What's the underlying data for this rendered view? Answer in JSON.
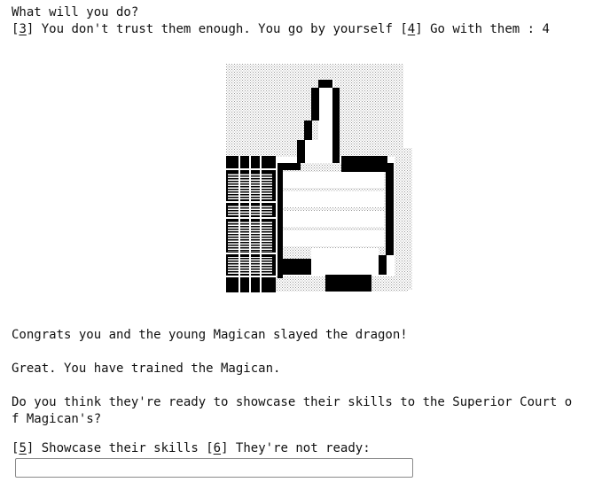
{
  "prompt1": {
    "question": "What will you do?",
    "opt3_key": "3",
    "opt3_text": " You don't trust them enough. You go by yourself ",
    "opt4_key": "4",
    "opt4_text": " Go with them : 4"
  },
  "result": {
    "congrats": "Congrats you and the young Magican slayed the dragon!",
    "trained": "Great. You have trained the Magican.",
    "question_line1": "Do you think they're ready to showcase their skills to the Superior Court o",
    "question_line2": "f Magican's?"
  },
  "prompt2": {
    "opt5_key": "5",
    "opt5_text": " Showcase their skills ",
    "opt6_key": "6",
    "opt6_text": " They're not ready:"
  },
  "input": {
    "value": ""
  },
  "art": {
    "icon": "thumbs-up",
    "ink_color": "#000000",
    "shade_color": "#b8b8b8"
  }
}
